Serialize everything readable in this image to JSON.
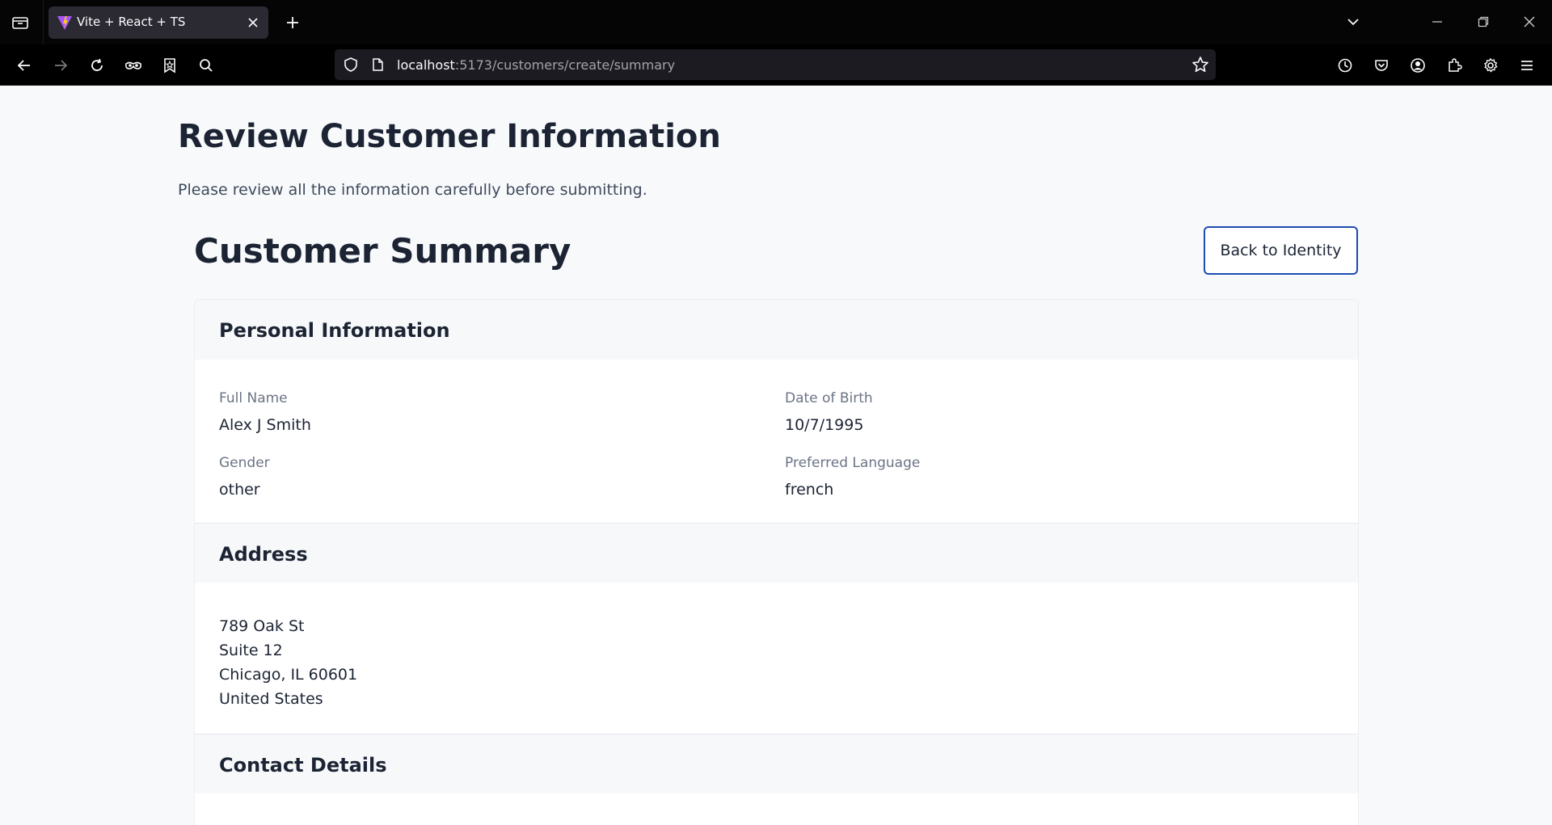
{
  "browser": {
    "tab": {
      "title": "Vite + React + TS"
    },
    "url": {
      "host": "localhost",
      "path": ":5173/customers/create/summary"
    }
  },
  "icons": {
    "tab_list": "tab-list-icon",
    "favicon": "vite-logo-icon",
    "close": "close-icon",
    "new_tab": "plus-icon",
    "chevron": "chevron-down-icon",
    "minimize": "minimize-icon",
    "restore": "restore-icon",
    "window_close": "window-close-icon",
    "back": "arrow-left-icon",
    "forward": "arrow-right-icon",
    "reload": "reload-icon",
    "private": "mask-icon",
    "bookmarks": "bookmark-star-icon",
    "search": "search-icon",
    "shield": "shield-icon",
    "page": "page-icon",
    "star": "star-icon",
    "history": "history-icon",
    "pocket": "pocket-icon",
    "account": "account-icon",
    "extensions": "puzzle-icon",
    "settings": "gear-icon",
    "menu": "hamburger-menu-icon"
  },
  "page": {
    "title": "Review Customer Information",
    "subtitle": "Please review all the information carefully before submitting."
  },
  "summary": {
    "title": "Customer Summary",
    "back_button": "Back to Identity",
    "personal": {
      "heading": "Personal Information",
      "full_name_label": "Full Name",
      "full_name": "Alex J Smith",
      "dob_label": "Date of Birth",
      "dob": "10/7/1995",
      "gender_label": "Gender",
      "gender": "other",
      "language_label": "Preferred Language",
      "language": "french"
    },
    "address": {
      "heading": "Address",
      "lines": [
        "789 Oak St",
        "Suite 12",
        "Chicago, IL 60601",
        "United States"
      ]
    },
    "contact": {
      "heading": "Contact Details"
    }
  },
  "colors": {
    "accent": "#1f4bb0",
    "text": "#1c2434",
    "muted": "#6b7385",
    "page_bg": "#f8f9fb"
  }
}
